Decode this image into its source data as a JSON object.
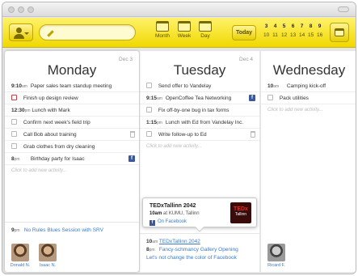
{
  "toolbar": {
    "views": [
      "Month",
      "Week",
      "Day"
    ],
    "today_label": "Today",
    "mini_days_row1": [
      "3",
      "4",
      "5",
      "6",
      "7",
      "8",
      "9"
    ],
    "mini_days_row2": [
      "10",
      "11",
      "12",
      "13",
      "14",
      "15",
      "16"
    ]
  },
  "columns": {
    "monday": {
      "name": "Monday",
      "date": "Dec 3",
      "items": [
        {
          "time": "9:10",
          "ampm": "am",
          "text": "Paper sales team standup meeting"
        },
        {
          "check": true,
          "text": "Finish up design review"
        },
        {
          "time": "12:30",
          "ampm": "pm",
          "text": "Lunch with Mark"
        },
        {
          "check": true,
          "text": "Confirm next week's field trip"
        },
        {
          "check": true,
          "text": "Call Bob about training"
        },
        {
          "check": true,
          "text": "Grab clothes from dry cleaning"
        },
        {
          "time": "8",
          "ampm": "pm",
          "text": "Birthday party for Isaac"
        }
      ],
      "add_hint": "Click to add new activity...",
      "bottom": {
        "time": "9",
        "ampm": "pm",
        "text": "No Rules Blues Session with SRV"
      },
      "people": [
        "Donald N.",
        "Isaac N."
      ]
    },
    "tuesday": {
      "name": "Tuesday",
      "date": "Dec 4",
      "items": [
        {
          "check": true,
          "text": "Send offer to Vandelay"
        },
        {
          "time": "9:15",
          "ampm": "am",
          "text": "OpenCoffee Tea Networking"
        },
        {
          "check": true,
          "text": "Fix off-by-one bug in tax forms"
        },
        {
          "time": "1:15",
          "ampm": "pm",
          "text": "Lunch with Ed from Vandelay Inc."
        },
        {
          "check": true,
          "text": "Write follow-up to Ed"
        }
      ],
      "add_hint": "Click to add new activity...",
      "popup": {
        "title": "TEDxTallinn 2042",
        "time": "10am",
        "where": "at KUMU, Tallinn",
        "fb": "On Facebook",
        "logo_top": "TEDx",
        "logo_bottom": "Tallinn"
      },
      "bottom": [
        {
          "time": "10",
          "ampm": "am",
          "text": "TEDxTallinn 2042"
        },
        {
          "time": "8",
          "ampm": "pm",
          "text": "Fancy-schmancy Gallery Opening"
        },
        {
          "text": "Let's not change the color of Facebook"
        }
      ]
    },
    "wednesday": {
      "name": "Wednesday",
      "date": "",
      "items": [
        {
          "time": "10",
          "ampm": "am",
          "text": "Camping kick-off"
        },
        {
          "check": true,
          "text": "Pack utilities"
        }
      ],
      "add_hint": "Click to add new activity...",
      "people": [
        "Ricard F."
      ]
    }
  }
}
